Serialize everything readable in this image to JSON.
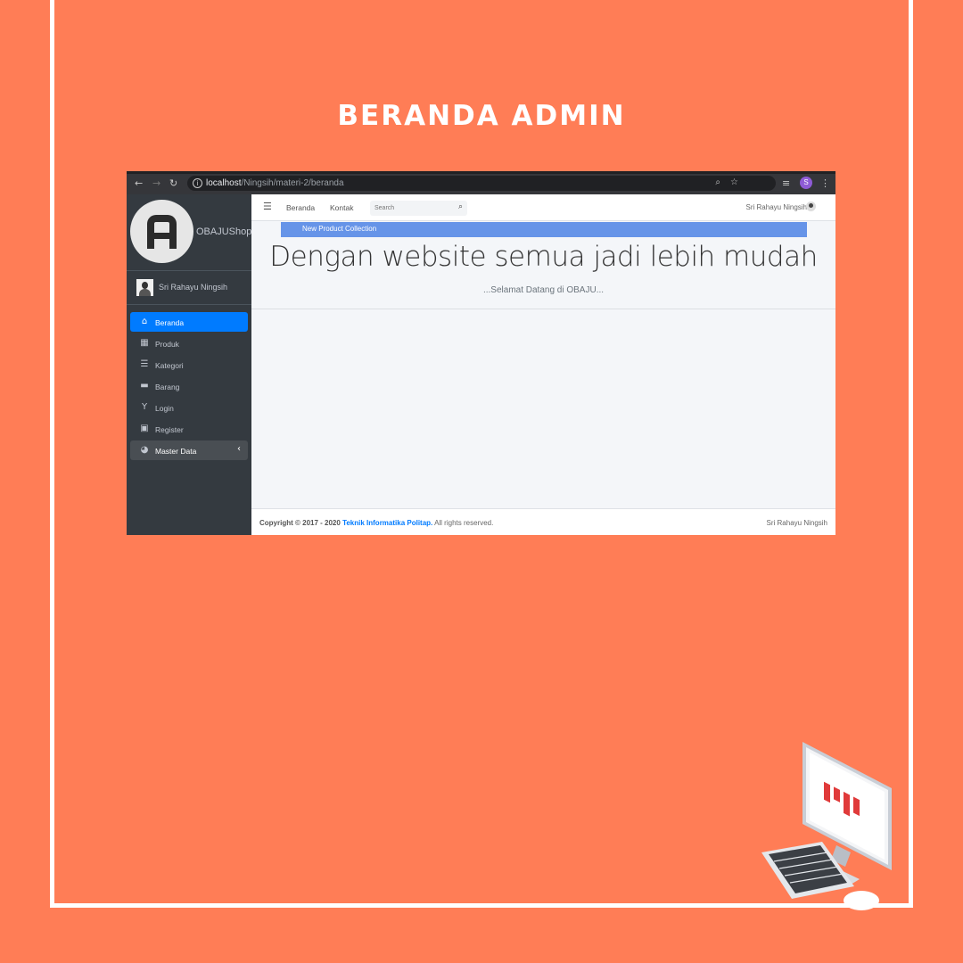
{
  "slide": {
    "title": "BERANDA ADMIN"
  },
  "browser": {
    "back_icon": "arrow-left-icon",
    "url_host": "localhost",
    "url_path": "/Ningsih/materi-2/beranda",
    "profile_initial": "S"
  },
  "sidebar": {
    "brand": "OBAJUShop",
    "user_name": "Sri Rahayu Ningsih",
    "items": [
      {
        "label": "Beranda",
        "icon": "home-icon",
        "active": true
      },
      {
        "label": "Produk",
        "icon": "grid-icon"
      },
      {
        "label": "Kategori",
        "icon": "list-icon"
      },
      {
        "label": "Barang",
        "icon": "archive-icon"
      },
      {
        "label": "Login",
        "icon": "login-icon"
      },
      {
        "label": "Register",
        "icon": "address-book-icon"
      },
      {
        "label": "Master Data",
        "icon": "dashboard-icon"
      }
    ]
  },
  "topnav": {
    "links": [
      "Beranda",
      "Kontak"
    ],
    "search_placeholder": "Search",
    "user_name": "Sri Rahayu Ningsih"
  },
  "main": {
    "banner": "New Product Collection",
    "headline": "Dengan website semua jadi lebih mudah",
    "subline": "...Selamat Datang di OBAJU..."
  },
  "footer": {
    "copyright": "Copyright © 2017 - 2020",
    "link": "Teknik Informatika Politap.",
    "rights": "All rights reserved.",
    "right_text": "Sri Rahayu Ningsih"
  },
  "colors": {
    "background": "#ff7d56",
    "accent": "#007bff",
    "banner": "#6694e8",
    "sidebar": "#343a40"
  }
}
